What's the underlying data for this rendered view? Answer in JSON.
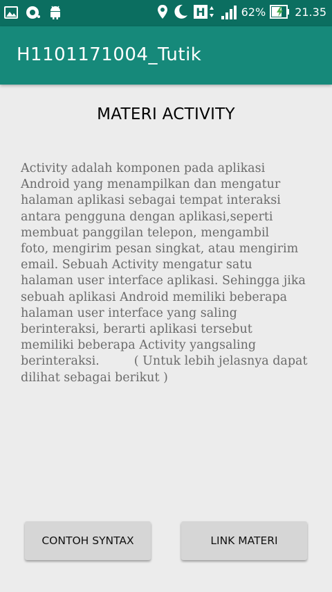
{
  "status_bar": {
    "battery_percent": "62%",
    "time": "21.35",
    "network_badge": "H",
    "icons": [
      "image-icon",
      "sync-icon",
      "android-icon",
      "location-icon",
      "moon-icon",
      "network-h-icon",
      "signal-icon",
      "battery-charging-icon"
    ]
  },
  "app_bar": {
    "title": "H1101171004_Tutik",
    "color": "#16897a"
  },
  "main": {
    "heading": "MATERI ACTIVITY",
    "body": "Activity adalah komponen pada aplikasi\nAndroid yang menampilkan dan mengatur\nhalaman aplikasi sebagai tempat interaksi\nantara pengguna dengan aplikasi,seperti\nmembuat panggilan telepon, mengambil\nfoto, mengirim pesan singkat, atau mengirim\nemail. Sebuah Activity mengatur satu\nhalaman user interface aplikasi. Sehingga jika\nsebuah aplikasi Android memiliki beberapa\nhalaman user interface yang saling\nberinteraksi, berarti aplikasi tersebut\nmemiliki beberapa Activity yangsaling\nberinteraksi.         ( Untuk lebih jelasnya dapat\ndilihat sebagai berikut )"
  },
  "buttons": {
    "contoh_syntax": "CONTOH SYNTAX",
    "link_materi": "LINK MATERI"
  }
}
